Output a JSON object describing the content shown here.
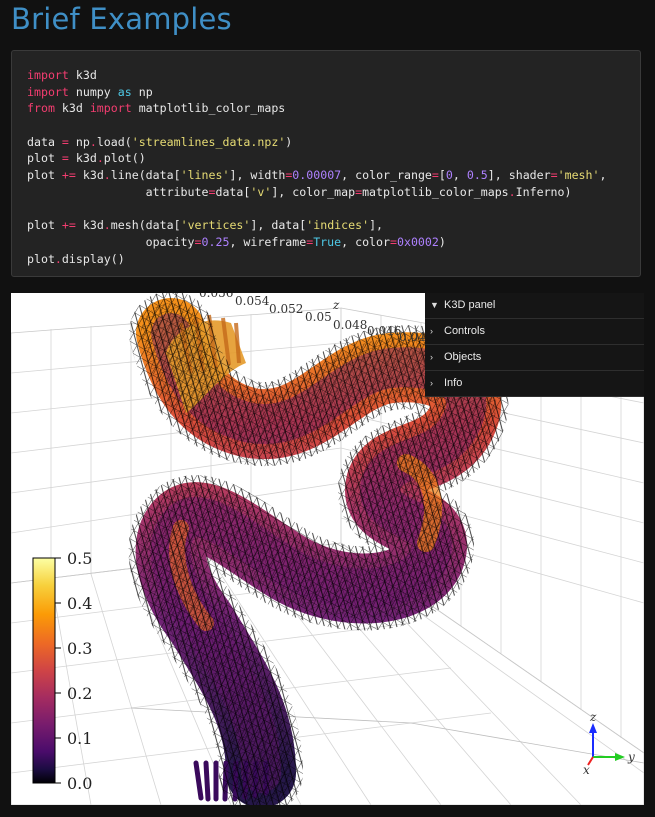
{
  "page": {
    "title": "Brief Examples"
  },
  "code": {
    "lines": [
      [
        {
          "t": "import",
          "c": "kw"
        },
        {
          "t": " k3d",
          "c": ""
        }
      ],
      [
        {
          "t": "import",
          "c": "kw"
        },
        {
          "t": " numpy ",
          "c": ""
        },
        {
          "t": "as",
          "c": "as"
        },
        {
          "t": " np",
          "c": ""
        }
      ],
      [
        {
          "t": "from",
          "c": "kw"
        },
        {
          "t": " k3d ",
          "c": ""
        },
        {
          "t": "import",
          "c": "kw"
        },
        {
          "t": " matplotlib_color_maps",
          "c": ""
        }
      ],
      [
        {
          "t": "",
          "c": ""
        }
      ],
      [
        {
          "t": "data ",
          "c": ""
        },
        {
          "t": "=",
          "c": "op"
        },
        {
          "t": " np",
          "c": ""
        },
        {
          "t": ".",
          "c": "op"
        },
        {
          "t": "load(",
          "c": ""
        },
        {
          "t": "'streamlines_data.npz'",
          "c": "str"
        },
        {
          "t": ")",
          "c": ""
        }
      ],
      [
        {
          "t": "plot ",
          "c": ""
        },
        {
          "t": "=",
          "c": "op"
        },
        {
          "t": " k3d",
          "c": ""
        },
        {
          "t": ".",
          "c": "op"
        },
        {
          "t": "plot()",
          "c": ""
        }
      ],
      [
        {
          "t": "plot ",
          "c": ""
        },
        {
          "t": "+=",
          "c": "op"
        },
        {
          "t": " k3d",
          "c": ""
        },
        {
          "t": ".",
          "c": "op"
        },
        {
          "t": "line(data[",
          "c": ""
        },
        {
          "t": "'lines'",
          "c": "str"
        },
        {
          "t": "], width",
          "c": ""
        },
        {
          "t": "=",
          "c": "op"
        },
        {
          "t": "0.00007",
          "c": "num"
        },
        {
          "t": ", color_range",
          "c": ""
        },
        {
          "t": "=",
          "c": "op"
        },
        {
          "t": "[",
          "c": ""
        },
        {
          "t": "0",
          "c": "num"
        },
        {
          "t": ", ",
          "c": ""
        },
        {
          "t": "0.5",
          "c": "num"
        },
        {
          "t": "], shader",
          "c": ""
        },
        {
          "t": "=",
          "c": "op"
        },
        {
          "t": "'mesh'",
          "c": "str"
        },
        {
          "t": ",",
          "c": ""
        }
      ],
      [
        {
          "t": "                 attribute",
          "c": ""
        },
        {
          "t": "=",
          "c": "op"
        },
        {
          "t": "data[",
          "c": ""
        },
        {
          "t": "'v'",
          "c": "str"
        },
        {
          "t": "], color_map",
          "c": ""
        },
        {
          "t": "=",
          "c": "op"
        },
        {
          "t": "matplotlib_color_maps",
          "c": ""
        },
        {
          "t": ".",
          "c": "op"
        },
        {
          "t": "Inferno)",
          "c": ""
        }
      ],
      [
        {
          "t": "",
          "c": ""
        }
      ],
      [
        {
          "t": "plot ",
          "c": ""
        },
        {
          "t": "+=",
          "c": "op"
        },
        {
          "t": " k3d",
          "c": ""
        },
        {
          "t": ".",
          "c": "op"
        },
        {
          "t": "mesh(data[",
          "c": ""
        },
        {
          "t": "'vertices'",
          "c": "str"
        },
        {
          "t": "], data[",
          "c": ""
        },
        {
          "t": "'indices'",
          "c": "str"
        },
        {
          "t": "],",
          "c": ""
        }
      ],
      [
        {
          "t": "                 opacity",
          "c": ""
        },
        {
          "t": "=",
          "c": "op"
        },
        {
          "t": "0.25",
          "c": "num"
        },
        {
          "t": ", wireframe",
          "c": ""
        },
        {
          "t": "=",
          "c": "op"
        },
        {
          "t": "True",
          "c": "as"
        },
        {
          "t": ", color",
          "c": ""
        },
        {
          "t": "=",
          "c": "op"
        },
        {
          "t": "0x0002",
          "c": "num"
        },
        {
          "t": ")",
          "c": ""
        }
      ],
      [
        {
          "t": "plot",
          "c": ""
        },
        {
          "t": ".",
          "c": "op"
        },
        {
          "t": "display()",
          "c": ""
        }
      ]
    ]
  },
  "k3d_panel": {
    "header": "K3D panel",
    "items": [
      "Controls",
      "Objects",
      "Info"
    ]
  },
  "colorbar": {
    "ticks": [
      "0.5",
      "0.4",
      "0.3",
      "0.2",
      "0.1",
      "0.0"
    ],
    "stops": [
      "#fcffa4",
      "#f7d13d",
      "#fb9b06",
      "#ed6925",
      "#cf4446",
      "#a52c60",
      "#781c6d",
      "#4a0c6b",
      "#1b0c41",
      "#000004"
    ]
  },
  "axes": {
    "z_label": "z",
    "y_label": "y",
    "x_label": "x",
    "z_ticks": [
      "0.056",
      "0.054",
      "0.052",
      "0.05",
      "0.048",
      "0.046",
      "0.04"
    ]
  }
}
